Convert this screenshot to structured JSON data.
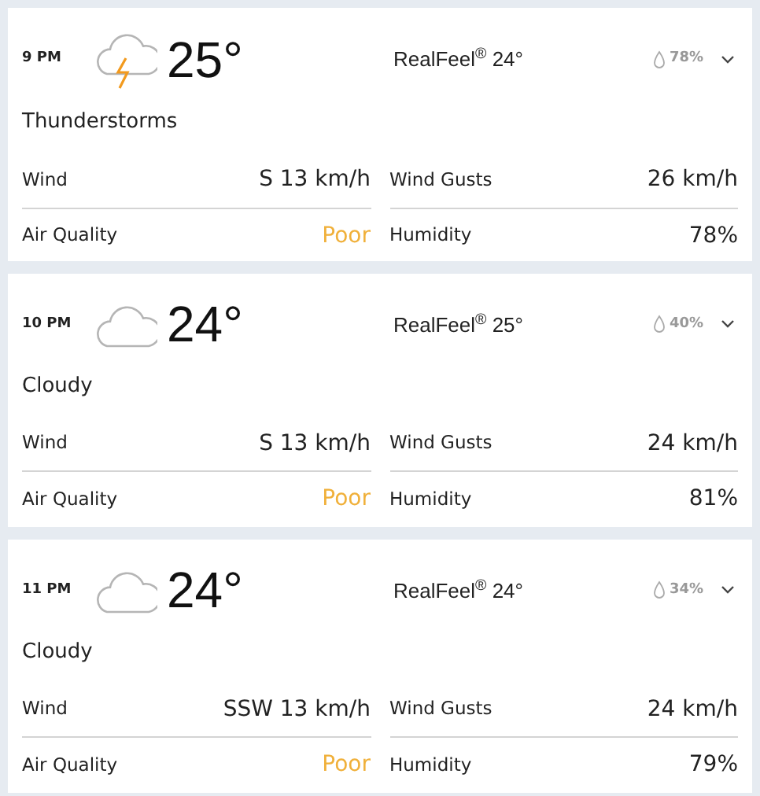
{
  "hours": [
    {
      "time": "9 PM",
      "kind": "thunderstorm",
      "temperature": "25°",
      "realfeel": "RealFeel$^{®}$ 24°",
      "precipitation": "78%",
      "expanded": false,
      "condition": "Thunderstorms",
      "details": [
        {
          "label": "Wind",
          "value": "S 13 km/h"
        },
        {
          "label": "Wind Gusts",
          "value": "26 km/h"
        },
        {
          "label": "Air Quality",
          "value": "Poor",
          "color": "#f0b03a"
        },
        {
          "label": "Humidity",
          "value": "78%"
        }
      ]
    },
    {
      "time": "10 PM",
      "kind": "cloudy",
      "temperature": "24°",
      "realfeel": "RealFeel$^{®}$ 25°",
      "precipitation": "40%",
      "expanded": false,
      "condition": "Cloudy",
      "details": [
        {
          "label": "Wind",
          "value": "S 13 km/h"
        },
        {
          "label": "Wind Gusts",
          "value": "24 km/h"
        },
        {
          "label": "Air Quality",
          "value": "Poor",
          "color": "#f0b03a"
        },
        {
          "label": "Humidity",
          "value": "81%"
        }
      ]
    },
    {
      "time": "11 PM",
      "kind": "cloudy",
      "temperature": "24°",
      "realfeel": "RealFeel$^{®}$ 24°",
      "precipitation": "34%",
      "expanded": false,
      "condition": "Cloudy",
      "details": [
        {
          "label": "Wind",
          "value": "SSW 13 km/h"
        },
        {
          "label": "Wind Gusts",
          "value": "24 km/h"
        },
        {
          "label": "Air Quality",
          "value": "Poor",
          "color": "#f0b03a"
        },
        {
          "label": "Humidity",
          "value": "79%"
        }
      ]
    }
  ]
}
